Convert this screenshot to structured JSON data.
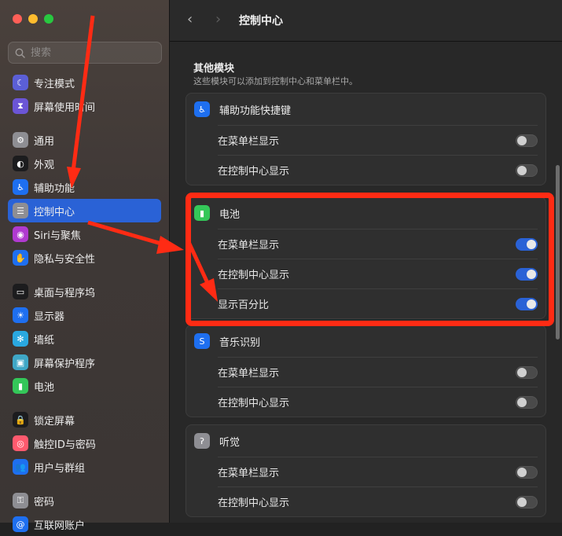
{
  "search": {
    "placeholder": "搜索"
  },
  "sidebar": {
    "groups": [
      [
        {
          "label": "专注模式",
          "icon": "moon-icon",
          "color": "#5b5fd6"
        },
        {
          "label": "屏幕使用时间",
          "icon": "hourglass-icon",
          "color": "#6b55d6"
        }
      ],
      [
        {
          "label": "通用",
          "icon": "gear-icon",
          "color": "#8e8e93"
        },
        {
          "label": "外观",
          "icon": "appearance-icon",
          "color": "#1c1c1e"
        },
        {
          "label": "辅助功能",
          "icon": "accessibility-icon",
          "color": "#1e6ff0"
        },
        {
          "label": "控制中心",
          "icon": "control-center-icon",
          "color": "#8e8e93",
          "active": true
        },
        {
          "label": "Siri与聚焦",
          "icon": "siri-icon",
          "color": "#b03ad0"
        },
        {
          "label": "隐私与安全性",
          "icon": "hand-icon",
          "color": "#1e6ff0"
        }
      ],
      [
        {
          "label": "桌面与程序坞",
          "icon": "dock-icon",
          "color": "#1c1c1e"
        },
        {
          "label": "显示器",
          "icon": "sun-icon",
          "color": "#1e6ff0"
        },
        {
          "label": "墙纸",
          "icon": "flower-icon",
          "color": "#2aa8e0"
        },
        {
          "label": "屏幕保护程序",
          "icon": "screensaver-icon",
          "color": "#3fa7c6"
        },
        {
          "label": "电池",
          "icon": "battery-icon",
          "color": "#34c759"
        }
      ],
      [
        {
          "label": "锁定屏幕",
          "icon": "lock-icon",
          "color": "#1c1c1e"
        },
        {
          "label": "触控ID与密码",
          "icon": "fingerprint-icon",
          "color": "#ff5a6e"
        },
        {
          "label": "用户与群组",
          "icon": "users-icon",
          "color": "#1e6ff0"
        }
      ],
      [
        {
          "label": "密码",
          "icon": "key-icon",
          "color": "#8e8e93"
        },
        {
          "label": "互联网账户",
          "icon": "at-icon",
          "color": "#1e6ff0"
        }
      ]
    ]
  },
  "toolbar": {
    "back": "‹",
    "forward": "›",
    "title": "控制中心"
  },
  "section": {
    "title": "其他模块",
    "subtitle": "这些模块可以添加到控制中心和菜单栏中。"
  },
  "modules": [
    {
      "name": "辅助功能快捷键",
      "icon": "accessibility-icon",
      "color": "#1e6ff0",
      "rows": [
        {
          "label": "在菜单栏显示",
          "on": false
        },
        {
          "label": "在控制中心显示",
          "on": false
        }
      ]
    },
    {
      "name": "电池",
      "icon": "battery-icon",
      "color": "#34c759",
      "rows": [
        {
          "label": "在菜单栏显示",
          "on": true
        },
        {
          "label": "在控制中心显示",
          "on": true
        },
        {
          "label": "显示百分比",
          "on": true
        }
      ]
    },
    {
      "name": "音乐识别",
      "icon": "shazam-icon",
      "color": "#1e6ff0",
      "rows": [
        {
          "label": "在菜单栏显示",
          "on": false
        },
        {
          "label": "在控制中心显示",
          "on": false
        }
      ]
    },
    {
      "name": "听觉",
      "icon": "ear-icon",
      "color": "#8e8e93",
      "rows": [
        {
          "label": "在菜单栏显示",
          "on": false
        },
        {
          "label": "在控制中心显示",
          "on": false
        }
      ]
    }
  ],
  "annotation_color": "#ff2b14"
}
